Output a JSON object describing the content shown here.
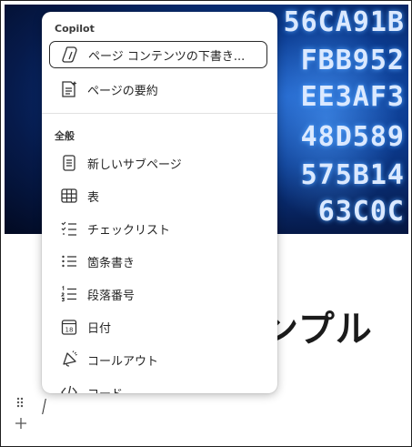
{
  "page": {
    "title": "ンプル",
    "banner_lines": [
      "56CA91B",
      "FBB952",
      "EE3AF3",
      "48D589",
      "575B14",
      "63C0C"
    ]
  },
  "menu": {
    "copilot_section": {
      "label": "Copilot",
      "items": [
        {
          "label": "ページ コンテンツの下書き...",
          "icon": "copilot-icon"
        },
        {
          "label": "ページの要約",
          "icon": "document-sparkle-icon"
        }
      ]
    },
    "general_section": {
      "label": "全般",
      "items": [
        {
          "label": "新しいサブページ",
          "icon": "document-icon"
        },
        {
          "label": "表",
          "icon": "table-icon"
        },
        {
          "label": "チェックリスト",
          "icon": "checklist-icon"
        },
        {
          "label": "箇条書き",
          "icon": "bullet-list-icon"
        },
        {
          "label": "段落番号",
          "icon": "numbered-list-icon"
        },
        {
          "label": "日付",
          "icon": "calendar-icon"
        },
        {
          "label": "コールアウト",
          "icon": "megaphone-icon"
        },
        {
          "label": "コード",
          "icon": "code-icon"
        }
      ]
    }
  },
  "colors": {
    "banner_dark": "#061a4a",
    "banner_light": "#1e5fc4",
    "focus_border": "#2a2a2a"
  }
}
